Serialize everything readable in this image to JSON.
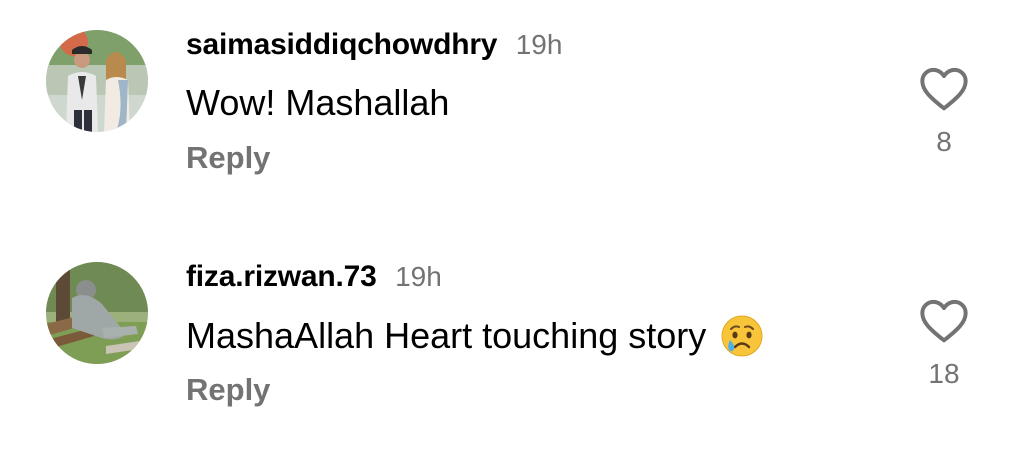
{
  "comments": [
    {
      "username": "saimasiddiqchowdhry",
      "time": "19h",
      "text": "Wow! Mashallah",
      "reply_label": "Reply",
      "like_count": "8",
      "avatar_icon": "avatar-photo-couple",
      "like_icon": "heart-outline-icon"
    },
    {
      "username": "fiza.rizwan.73",
      "time": "19h",
      "text": "MashaAllah Heart touching story",
      "emoji": "crying-face-emoji",
      "reply_label": "Reply",
      "like_count": "18",
      "avatar_icon": "avatar-photo-person-bench",
      "like_icon": "heart-outline-icon"
    }
  ],
  "colors": {
    "text_primary": "#000000",
    "text_secondary": "#737373",
    "background": "#ffffff"
  }
}
